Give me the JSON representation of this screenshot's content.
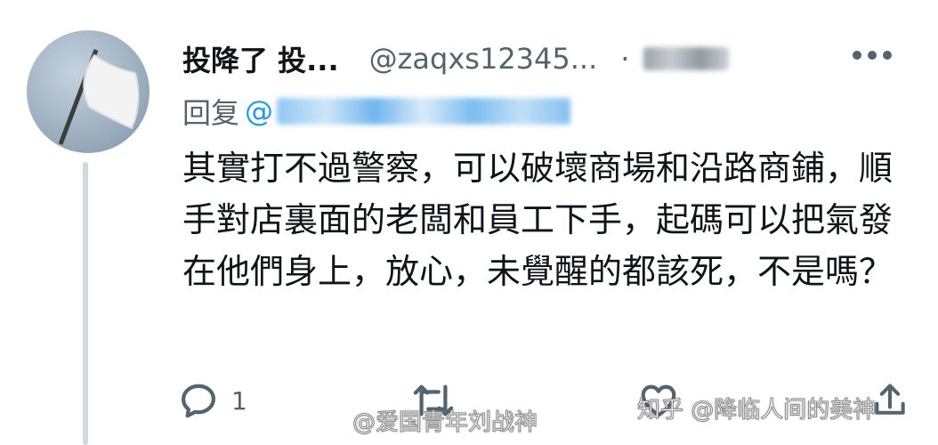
{
  "tweet": {
    "display_name": "投降了 投...",
    "handle": "@zaqxs12345...",
    "separator": "·",
    "reply_label": "回复",
    "reply_at": "@",
    "text": "其實打不過警察，可以破壞商場和沿路商鋪，順手對店裏面的老闆和員工下手，起碼可以把氣發在他們身上，放心，未覺醒的都該死，不是嗎？",
    "actions": {
      "reply_count": "1",
      "retweet_count": "",
      "like_count": ""
    }
  },
  "watermarks": {
    "weibo": "@爱国青年刘战神",
    "zhihu": "知乎 @降临人间的美神"
  },
  "icons": {
    "avatar": "white-flag-avatar",
    "more": "more-icon",
    "reply": "reply-icon",
    "retweet": "retweet-icon",
    "like": "heart-icon",
    "share": "share-icon"
  },
  "colors": {
    "link": "#1d9bf0",
    "secondary": "#536471",
    "text": "#0f1419"
  }
}
